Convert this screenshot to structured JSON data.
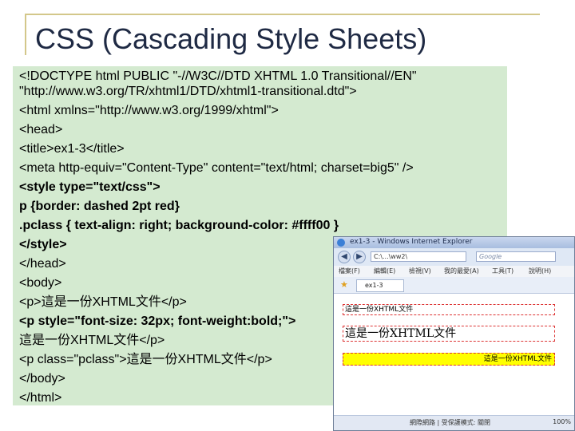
{
  "slide": {
    "title": "CSS (Cascading Style Sheets)"
  },
  "code": [
    "<!DOCTYPE html PUBLIC \"-//W3C//DTD XHTML 1.0 Transitional//EN\"",
    "    \"http://www.w3.org/TR/xhtml1/DTD/xhtml1-transitional.dtd\">",
    "<html xmlns=\"http://www.w3.org/1999/xhtml\">",
    "<head>",
    "<title>ex1-3</title>",
    "<meta http-equiv=\"Content-Type\" content=\"text/html; charset=big5\" />",
    "<style type=\"text/css\">",
    "   p  {border: dashed 2pt red}",
    "   .pclass  { text-align: right; background-color: #ffff00 }",
    "</style>",
    "</head>",
    "<body>",
    "<p>這是一份XHTML文件</p>",
    "<p style=\"font-size: 32px; font-weight:bold;\">",
    "這是一份XHTML文件</p>",
    "<p class=\"pclass\">這是一份XHTML文件</p>",
    "</body>",
    "</html>"
  ],
  "browser": {
    "window_title": "ex1-3 - Windows Internet Explorer",
    "url": "C:\\...\\ww2\\",
    "search_placeholder": "Google",
    "menu": [
      "檔案(F)",
      "編輯(E)",
      "檢視(V)",
      "我的最愛(A)",
      "工具(T)",
      "說明(H)"
    ],
    "tab_label": "ex1-3",
    "back_icon": "back-arrow-icon",
    "forward_icon": "forward-arrow-icon",
    "p1_text": "這是一份XHTML文件",
    "p2_text": "這是一份XHTML文件",
    "p3_text": "這是一份XHTML文件",
    "status_text": "網際網路 | 受保護模式: 關閉",
    "zoom": "100%"
  }
}
